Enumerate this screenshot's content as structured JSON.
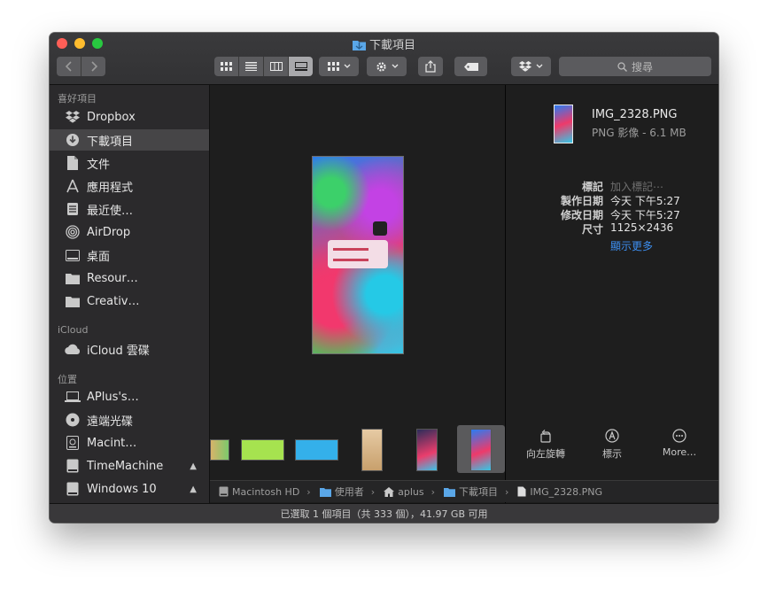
{
  "window": {
    "title": "下載項目",
    "folder_icon": "folder-icon"
  },
  "toolbar": {
    "nav": [
      "back-icon",
      "forward-icon"
    ],
    "view_modes": [
      "icon-view-icon",
      "list-view-icon",
      "column-view-icon",
      "gallery-view-icon"
    ],
    "active_view": "gallery",
    "group_icon": "group-icon",
    "action_icon": "gear-icon",
    "share_icon": "share-icon",
    "tag_icon": "tag-icon",
    "dropbox_icon": "dropbox-icon",
    "search_placeholder": "搜尋"
  },
  "sidebar": {
    "favorites_header": "喜好項目",
    "favorites": [
      {
        "label": "Dropbox",
        "icon": "dropbox-icon"
      },
      {
        "label": "下載項目",
        "icon": "download-icon",
        "selected": true
      },
      {
        "label": "文件",
        "icon": "document-icon"
      },
      {
        "label": "應用程式",
        "icon": "applications-icon"
      },
      {
        "label": "最近使…",
        "icon": "recents-icon"
      },
      {
        "label": "AirDrop",
        "icon": "airdrop-icon"
      },
      {
        "label": "桌面",
        "icon": "desktop-icon"
      },
      {
        "label": "Resour…",
        "icon": "folder-icon"
      },
      {
        "label": "Creativ…",
        "icon": "folder-icon"
      }
    ],
    "icloud_header": "iCloud",
    "icloud": [
      {
        "label": "iCloud 雲碟",
        "icon": "cloud-icon"
      }
    ],
    "locations_header": "位置",
    "locations": [
      {
        "label": "APlus's…",
        "icon": "laptop-icon"
      },
      {
        "label": "遠端光碟",
        "icon": "disc-icon"
      },
      {
        "label": "Macint…",
        "icon": "harddisk-icon"
      },
      {
        "label": "TimeMachine",
        "icon": "drive-icon",
        "eject": true
      },
      {
        "label": "Windows 10",
        "icon": "drive-icon",
        "eject": true
      }
    ]
  },
  "inspector": {
    "file_name": "IMG_2328.PNG",
    "file_type": "PNG 影像 - 6.1 MB",
    "rows": [
      {
        "label": "標記",
        "value": "加入標記⋯",
        "placeholder": true
      },
      {
        "label": "製作日期",
        "value": "今天 下午5:27"
      },
      {
        "label": "修改日期",
        "value": "今天 下午5:27"
      },
      {
        "label": "尺寸",
        "value": "1125×2436"
      }
    ],
    "show_more": "顯示更多",
    "actions": [
      {
        "label": "向左旋轉",
        "icon": "rotate-left-icon"
      },
      {
        "label": "標示",
        "icon": "markup-icon"
      },
      {
        "label": "More…",
        "icon": "more-icon"
      }
    ]
  },
  "pathbar": [
    {
      "label": "Macintosh HD",
      "icon": "harddisk-icon"
    },
    {
      "label": "使用者",
      "icon": "folder-icon"
    },
    {
      "label": "aplus",
      "icon": "home-icon"
    },
    {
      "label": "下載項目",
      "icon": "folder-icon"
    },
    {
      "label": "IMG_2328.PNG",
      "icon": "file-icon"
    }
  ],
  "statusbar": {
    "text": "已選取 1 個項目（共 333 個），41.97 GB 可用"
  }
}
